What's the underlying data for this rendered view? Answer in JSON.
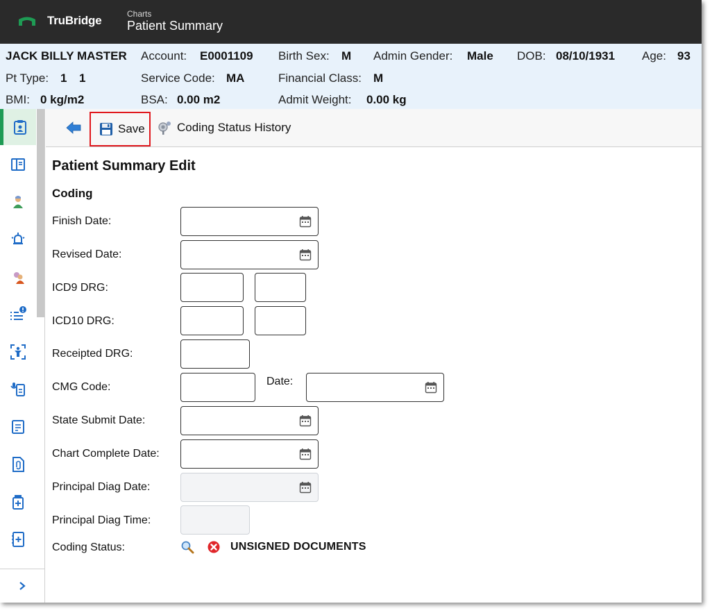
{
  "app": {
    "brand": "TruBridge",
    "breadcrumb": "Charts",
    "title": "Patient Summary"
  },
  "patient": {
    "name": "JACK BILLY MASTER",
    "account_label": "Account:",
    "account": "E0001109",
    "birth_sex_label": "Birth Sex:",
    "birth_sex": "M",
    "admin_gender_label": "Admin Gender:",
    "admin_gender": "Male",
    "dob_label": "DOB:",
    "dob": "08/10/1931",
    "age_label": "Age:",
    "age": "93",
    "pt_type_label": "Pt Type:",
    "pt_type": "1",
    "pt_type_2": "1",
    "service_code_label": "Service Code:",
    "service_code": "MA",
    "financial_class_label": "Financial Class:",
    "financial_class": "M",
    "bmi_label": "BMI:",
    "bmi": "0 kg/m2",
    "bsa_label": "BSA:",
    "bsa": "0.00 m2",
    "admit_weight_label": "Admit Weight:",
    "admit_weight": "0.00 kg"
  },
  "toolbar": {
    "save_label": "Save",
    "history_label": "Coding Status History"
  },
  "form": {
    "page_title": "Patient Summary Edit",
    "section_title": "Coding",
    "finish_date_label": "Finish Date:",
    "finish_date": "",
    "revised_date_label": "Revised Date:",
    "revised_date": "",
    "icd9_drg_label": "ICD9 DRG:",
    "icd9_drg": [
      "",
      ""
    ],
    "icd10_drg_label": "ICD10 DRG:",
    "icd10_drg": [
      "",
      ""
    ],
    "receipted_drg_label": "Receipted DRG:",
    "receipted_drg": "",
    "cmg_code_label": "CMG Code:",
    "cmg_code": "",
    "cmg_date_label": "Date:",
    "cmg_date": "",
    "state_submit_date_label": "State Submit Date:",
    "state_submit_date": "",
    "chart_complete_date_label": "Chart Complete Date:",
    "chart_complete_date": "",
    "principal_diag_date_label": "Principal Diag Date:",
    "principal_diag_date": "",
    "principal_diag_time_label": "Principal Diag Time:",
    "principal_diag_time": "",
    "coding_status_label": "Coding Status:",
    "coding_status": "UNSIGNED DOCUMENTS"
  },
  "icons": {
    "nav": [
      "patient-summary-icon",
      "layout-panel-icon",
      "person-icon",
      "alarm-icon",
      "allergy-person-icon",
      "task-list-icon",
      "vitals-icon",
      "dictation-icon",
      "notes-icon",
      "attachment-icon",
      "medication-icon",
      "add-document-icon"
    ],
    "toolbar": [
      "back-arrow-icon",
      "save-icon",
      "coding-history-icon"
    ],
    "status": [
      "search-icon",
      "error-icon"
    ]
  },
  "colors": {
    "topbar": "#2a2a2a",
    "brand_green": "#1e9b54",
    "header_bg": "#e8f2fb",
    "nav_icon": "#1f6cc7",
    "highlight": "#e0181d"
  }
}
